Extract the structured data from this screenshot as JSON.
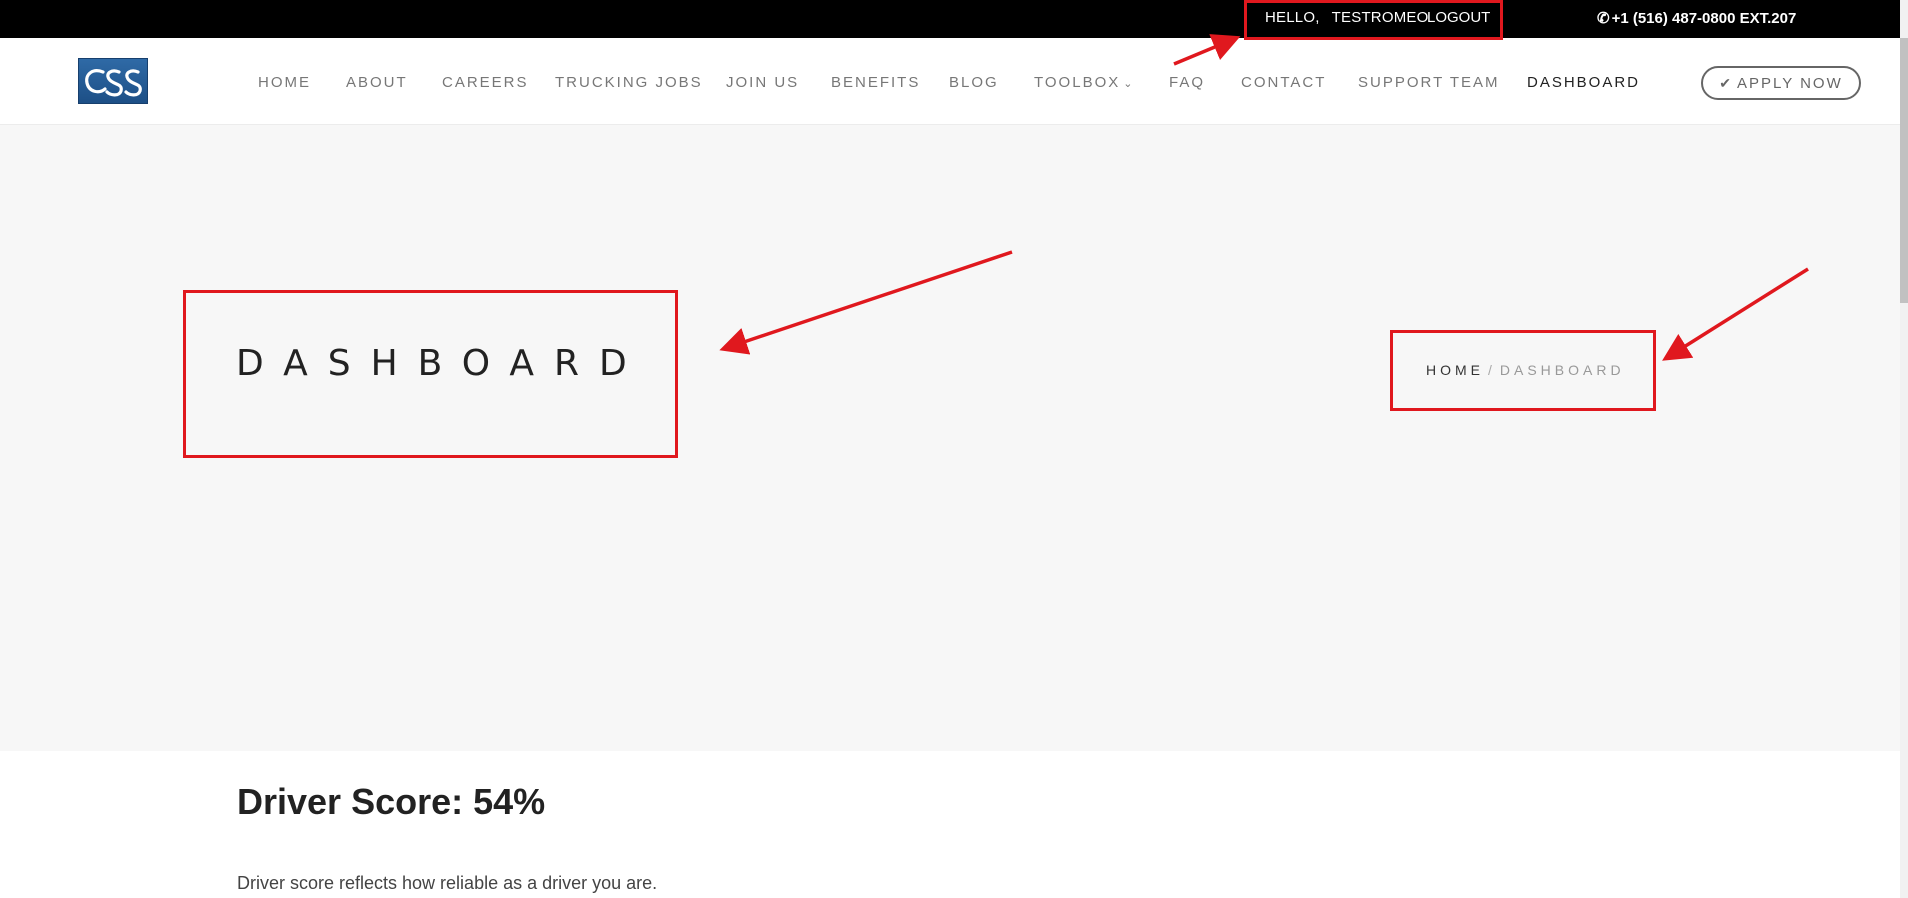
{
  "topbar": {
    "greeting": "HELLO,",
    "username": "TESTROMEO",
    "logout_label": "LOGOUT",
    "phone": "+1 (516) 487-0800 EXT.207",
    "phone_icon": "phone-icon"
  },
  "logo": {
    "text": "CSS"
  },
  "nav": {
    "items": [
      {
        "label": "HOME"
      },
      {
        "label": "ABOUT"
      },
      {
        "label": "CAREERS"
      },
      {
        "label": "TRUCKING JOBS"
      },
      {
        "label": "JOIN US"
      },
      {
        "label": "BENEFITS"
      },
      {
        "label": "BLOG"
      },
      {
        "label": "TOOLBOX",
        "has_dropdown": true
      },
      {
        "label": "FAQ"
      },
      {
        "label": "CONTACT"
      },
      {
        "label": "SUPPORT TEAM"
      },
      {
        "label": "DASHBOARD",
        "active": true
      }
    ],
    "apply_label": "APPLY NOW"
  },
  "hero": {
    "title": "DASHBOARD",
    "breadcrumb": {
      "home": "HOME",
      "separator": "/",
      "current": "DASHBOARD"
    }
  },
  "content": {
    "score_heading": "Driver Score: 54%",
    "description": "Driver score reflects how reliable as a driver you are."
  },
  "colors": {
    "topbar_bg": "#000000",
    "hero_bg": "#f7f7f7",
    "annotation_red": "#e0181e",
    "logo_blue": "#1d4f86"
  }
}
